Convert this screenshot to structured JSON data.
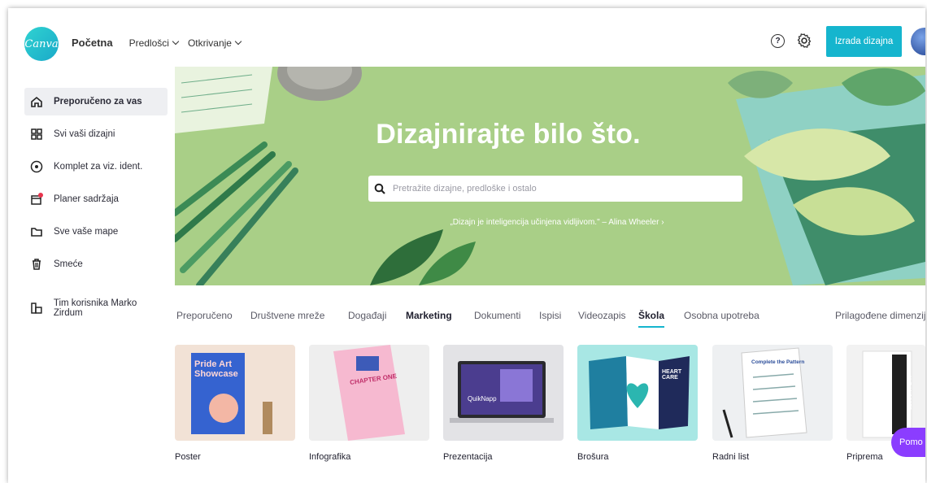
{
  "logo_text": "Canva",
  "nav": {
    "home": "Početna",
    "templates": "Predlošci",
    "discover": "Otkrivanje"
  },
  "header": {
    "create_button": "Izrada dizajna",
    "help_glyph": "?"
  },
  "sidebar": {
    "items": [
      {
        "label": "Preporučeno za vas",
        "icon": "home-icon",
        "active": true
      },
      {
        "label": "Svi vaši dizajni",
        "icon": "designs-icon"
      },
      {
        "label": "Komplet za viz. ident.",
        "icon": "brand-kit-icon"
      },
      {
        "label": "Planer sadržaja",
        "icon": "calendar-icon"
      },
      {
        "label": "Sve vaše mape",
        "icon": "folder-icon"
      },
      {
        "label": "Smeće",
        "icon": "trash-icon"
      },
      {
        "label": "Tim korisnika Marko Zirdum",
        "icon": "team-icon"
      }
    ]
  },
  "hero": {
    "title": "Dizajnirajte bilo što.",
    "search_placeholder": "Pretražite dizajne, predloške i ostalo",
    "quote": "„Dizajn je inteligencija učinjena vidljivom.\" – Alina Wheeler ›"
  },
  "categories": [
    {
      "label": "Preporučeno"
    },
    {
      "label": "Društvene mreže"
    },
    {
      "label": "Događaji"
    },
    {
      "label": "Marketing",
      "bold": true
    },
    {
      "label": "Dokumenti"
    },
    {
      "label": "Ispisi"
    },
    {
      "label": "Videozapis"
    },
    {
      "label": "Škola",
      "bold": true,
      "active": true
    },
    {
      "label": "Osobna upotreba"
    },
    {
      "label": "Prilagođene dimenzije"
    }
  ],
  "cards": [
    {
      "label": "Poster",
      "thumb_text": "Pride Art Showcase"
    },
    {
      "label": "Infografika",
      "thumb_text": "CHAPTER ONE"
    },
    {
      "label": "Prezentacija",
      "thumb_text": "QuikNapp"
    },
    {
      "label": "Brošura",
      "thumb_text": "HEART CARE"
    },
    {
      "label": "Radni list",
      "thumb_text": "Complete the Pattern"
    },
    {
      "label": "Priprema",
      "thumb_text": "LESSON PLAN"
    }
  ],
  "help_bubble": "Pomo",
  "colors": {
    "accent": "#15b5ce",
    "hero_bg": "#a9cf87",
    "help_purple": "#8b3dff"
  }
}
